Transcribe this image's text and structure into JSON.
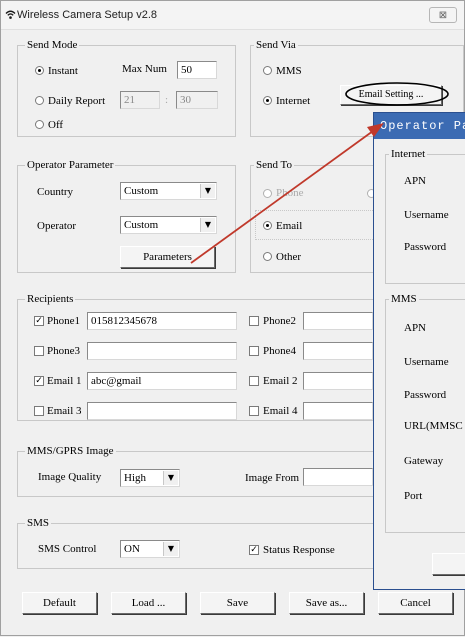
{
  "window": {
    "title": "Wireless Camera Setup  v2.8",
    "close_label": "⊠"
  },
  "send_mode": {
    "label": "Send Mode",
    "instant": "Instant",
    "daily": "Daily Report",
    "off": "Off",
    "max_num_label": "Max Num",
    "max_num_value": "50",
    "daily_from": "21",
    "daily_to": "30",
    "selected": "instant"
  },
  "send_via": {
    "label": "Send Via",
    "mms": "MMS",
    "internet": "Internet",
    "email_setting": "Email Setting ...",
    "selected": "internet"
  },
  "operator": {
    "label": "Operator Parameter",
    "country_label": "Country",
    "country_value": "Custom",
    "operator_label": "Operator",
    "operator_value": "Custom",
    "parameters_button": "Parameters"
  },
  "send_to": {
    "label": "Send To",
    "phone": "Phone",
    "email": "Email",
    "other": "Other",
    "selected": "email"
  },
  "recipients": {
    "label": "Recipients",
    "phone1_label": "Phone1",
    "phone1_value": "015812345678",
    "phone2_label": "Phone2",
    "phone3_label": "Phone3",
    "phone4_label": "Phone4",
    "email1_label": "Email 1",
    "email1_value": "abc@gmail",
    "email2_label": "Email 2",
    "email3_label": "Email 3",
    "email4_label": "Email 4"
  },
  "mms_gprs": {
    "label": "MMS/GPRS Image",
    "quality_label": "Image Quality",
    "quality_value": "High",
    "image_from_label": "Image From"
  },
  "sms": {
    "label": "SMS",
    "control_label": "SMS Control",
    "control_value": "ON",
    "status_response": "Status Response"
  },
  "footer": {
    "default": "Default",
    "load": "Load ...",
    "save": "Save",
    "save_as": "Save as...",
    "cancel": "Cancel"
  },
  "popup": {
    "title": "Operator Par",
    "internet_label": "Internet",
    "apn": "APN",
    "username": "Username",
    "password": "Password",
    "mms_label": "MMS",
    "mms_apn": "APN",
    "mms_username": "Username",
    "mms_password": "Password",
    "mms_url": "URL(MMSC",
    "gateway": "Gateway",
    "port": "Port"
  },
  "colors": {
    "popup_title_bg": "#3b6bb3",
    "annotation_arrow": "#c0392b",
    "wifi_icon": "#1a1a1a"
  }
}
